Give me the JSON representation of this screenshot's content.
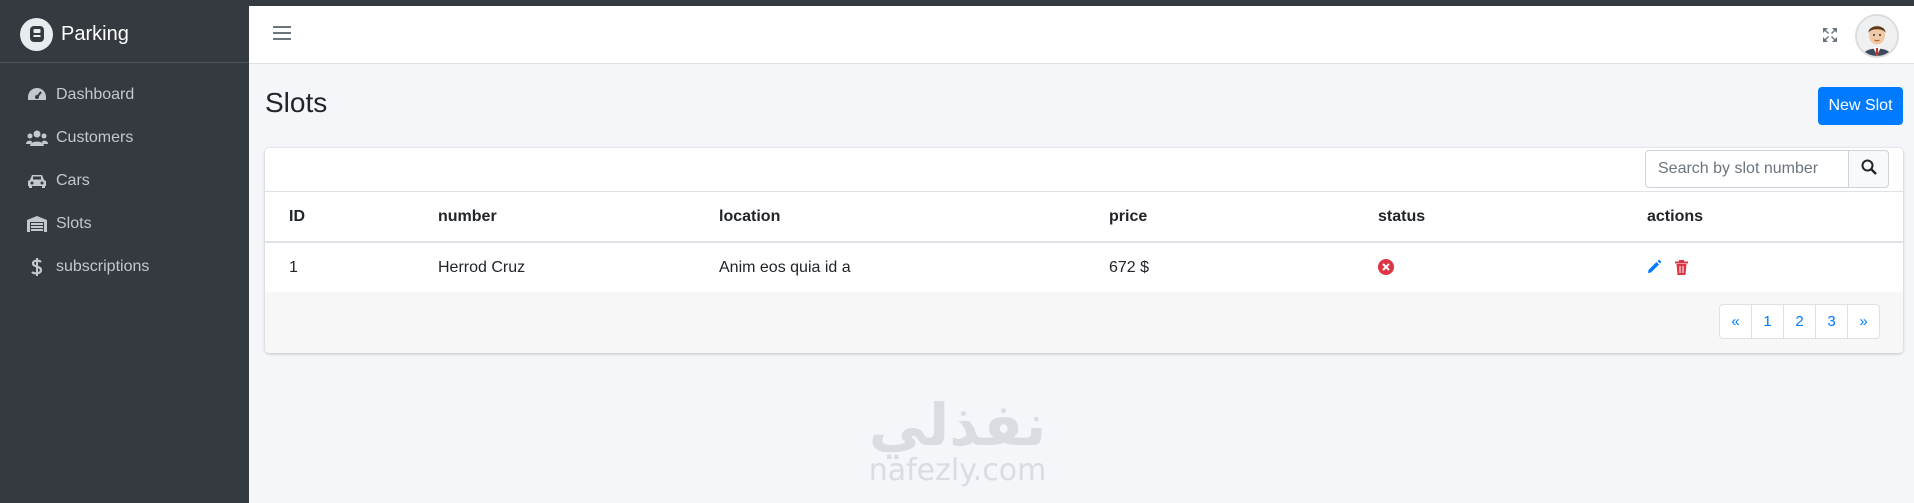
{
  "brand": {
    "name": "Parking"
  },
  "sidebar": {
    "items": [
      {
        "label": "Dashboard",
        "icon": "dashboard-icon"
      },
      {
        "label": "Customers",
        "icon": "users-icon"
      },
      {
        "label": "Cars",
        "icon": "car-icon"
      },
      {
        "label": "Slots",
        "icon": "warehouse-icon"
      },
      {
        "label": "subscriptions",
        "icon": "dollar-icon"
      }
    ]
  },
  "header": {
    "title": "Slots",
    "new_button_label": "New Slot"
  },
  "search": {
    "placeholder": "Search by slot number"
  },
  "table": {
    "columns": [
      "ID",
      "number",
      "location",
      "price",
      "status",
      "actions"
    ],
    "rows": [
      {
        "id": "1",
        "number": "Herrod Cruz",
        "location": "Anim eos quia id a",
        "price": "672 $",
        "status": "inactive"
      }
    ]
  },
  "pagination": {
    "prev": "«",
    "pages": [
      "1",
      "2",
      "3"
    ],
    "next": "»"
  },
  "watermark": {
    "arabic": "نفذلي",
    "latin": "nafezly.com"
  },
  "colors": {
    "sidebar": "#343a40",
    "primary": "#007bff",
    "danger": "#dc3545",
    "background": "#f4f6f9"
  }
}
